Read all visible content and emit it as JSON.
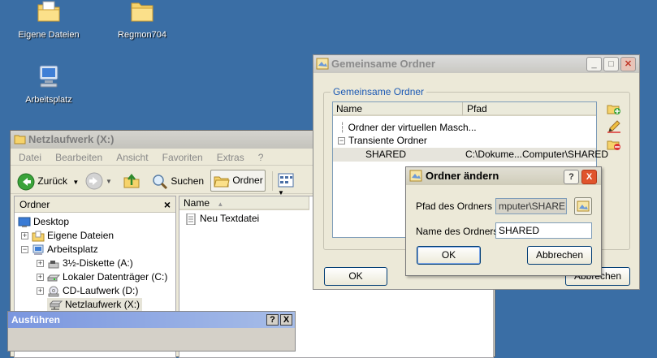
{
  "desktop": {
    "icons": [
      {
        "label": "Eigene Dateien"
      },
      {
        "label": "Regmon704"
      },
      {
        "label": "Arbeitsplatz"
      }
    ]
  },
  "explorer": {
    "title": "Netzlaufwerk (X:)",
    "menu": [
      "Datei",
      "Bearbeiten",
      "Ansicht",
      "Favoriten",
      "Extras",
      "?"
    ],
    "toolbar": {
      "back": "Zurück",
      "search": "Suchen",
      "folders": "Ordner"
    },
    "pane_title": "Ordner",
    "pane_close": "×",
    "tree": [
      {
        "label": "Desktop"
      },
      {
        "label": "Eigene Dateien",
        "expander": "+"
      },
      {
        "label": "Arbeitsplatz",
        "expander": "−"
      },
      {
        "label": "3½-Diskette (A:)",
        "expander": "+"
      },
      {
        "label": "Lokaler Datenträger (C:)",
        "expander": "+"
      },
      {
        "label": "CD-Laufwerk (D:)",
        "expander": "+"
      },
      {
        "label": "Netzlaufwerk (X:)"
      }
    ],
    "list_header": {
      "name": "Name"
    },
    "files": [
      {
        "name": "Neu Textdatei"
      }
    ]
  },
  "run_dialog": {
    "title": "Ausführen",
    "help": "?",
    "close": "X"
  },
  "shared_dialog": {
    "title": "Gemeinsame Ordner",
    "group_label": "Gemeinsame Ordner",
    "columns": {
      "name": "Name",
      "path": "Pfad"
    },
    "rows": [
      {
        "name": "Ordner der virtuellen Masch...",
        "path": ""
      },
      {
        "name": "Transiente Ordner",
        "path": "",
        "expander": "−"
      },
      {
        "name": "SHARED",
        "path": "C:\\Dokume...Computer\\SHARED"
      }
    ],
    "ok": "OK",
    "cancel": "Abbrechen"
  },
  "edit_dialog": {
    "title": "Ordner ändern",
    "help": "?",
    "close": "X",
    "path_label": "Pfad des Ordners",
    "path_value": "mputer\\SHARED",
    "name_label": "Name des Ordners",
    "name_value": "SHARED",
    "ok": "OK",
    "cancel": "Abbrechen"
  }
}
